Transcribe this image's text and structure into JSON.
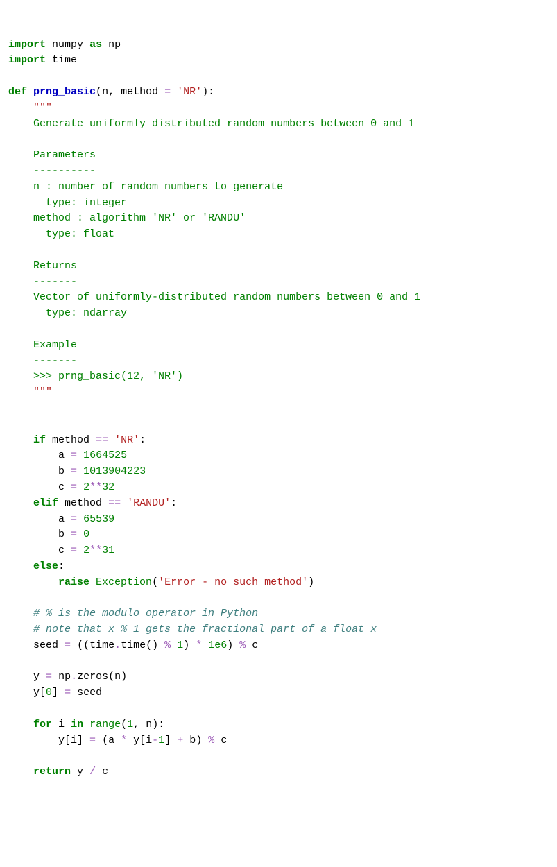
{
  "code": {
    "l01": {
      "kw_import": "import",
      "numpy": "numpy",
      "kw_as": "as",
      "np": "np"
    },
    "l02": {
      "kw_import": "import",
      "time": "time"
    },
    "l04": {
      "kw_def": "def",
      "name": "prng_basic",
      "lp": "(",
      "n": "n",
      "c1": ", ",
      "method": "method",
      "eq": "=",
      "str": "'NR'",
      "rp": "):"
    },
    "l05": {
      "q": "\"\"\""
    },
    "l06": {
      "t": "Generate uniformly distributed random numbers between 0 and 1"
    },
    "l08": {
      "t": "Parameters"
    },
    "l09": {
      "t": "----------"
    },
    "l10": {
      "t": "n : number of random numbers to generate"
    },
    "l11": {
      "t": "  type: integer"
    },
    "l12": {
      "t": "method : algorithm 'NR' or 'RANDU'"
    },
    "l13": {
      "t": "  type: float"
    },
    "l15": {
      "t": "Returns"
    },
    "l16": {
      "t": "-------"
    },
    "l17": {
      "t": "Vector of uniformly-distributed random numbers between 0 and 1"
    },
    "l18": {
      "t": "  type: ndarray"
    },
    "l20": {
      "t": "Example"
    },
    "l21": {
      "t": "-------"
    },
    "l22": {
      "t": ">>> prng_basic(12, 'NR')"
    },
    "l23": {
      "q": "\"\"\""
    },
    "l26": {
      "kw_if": "if",
      "method": "method",
      "eq": "==",
      "str": "'NR'",
      "colon": ":"
    },
    "l27": {
      "a": "a",
      "eq": "=",
      "num": "1664525"
    },
    "l28": {
      "b": "b",
      "eq": "=",
      "num": "1013904223"
    },
    "l29": {
      "c": "c",
      "eq": "=",
      "n2": "2",
      "op": "**",
      "n32": "32"
    },
    "l30": {
      "kw_elif": "elif",
      "method": "method",
      "eq": "==",
      "str": "'RANDU'",
      "colon": ":"
    },
    "l31": {
      "a": "a",
      "eq": "=",
      "num": "65539"
    },
    "l32": {
      "b": "b",
      "eq": "=",
      "num": "0"
    },
    "l33": {
      "c": "c",
      "eq": "=",
      "n2": "2",
      "op": "**",
      "n31": "31"
    },
    "l34": {
      "kw_else": "else",
      "colon": ":"
    },
    "l35": {
      "kw_raise": "raise",
      "exc": "Exception",
      "lp": "(",
      "str": "'Error - no such method'",
      "rp": ")"
    },
    "l37": {
      "t": "# % is the modulo operator in Python"
    },
    "l38": {
      "t": "# note that x % 1 gets the fractional part of a float x"
    },
    "l39": {
      "seed": "seed",
      "eq": "=",
      "p1": "((time",
      "dot": ".",
      "time": "time()",
      "mod": "%",
      "n1": "1",
      "p2": ")",
      "mul": "*",
      "e6": "1e6",
      "p3": ")",
      "mod2": "%",
      "c": "c"
    },
    "l41": {
      "y": "y",
      "eq": "=",
      "np": "np",
      "dot": ".",
      "zeros": "zeros(n)"
    },
    "l42": {
      "y": "y[",
      "zero": "0",
      "rb": "]",
      "eq": "=",
      "seed": "seed"
    },
    "l44": {
      "kw_for": "for",
      "i": "i",
      "kw_in": "in",
      "range": "range",
      "lp": "(",
      "n1": "1",
      "c": ",",
      "n": "n):"
    },
    "l45": {
      "yi": "y[i]",
      "eq": "=",
      "expr1": "(a",
      "mul": "*",
      "expr2": "y[i",
      "minus": "-",
      "one": "1",
      "expr3": "]",
      "plus": "+",
      "b": "b)",
      "mod": "%",
      "c": "c"
    },
    "l47": {
      "kw_return": "return",
      "y": "y",
      "div": "/",
      "c": "c"
    }
  }
}
